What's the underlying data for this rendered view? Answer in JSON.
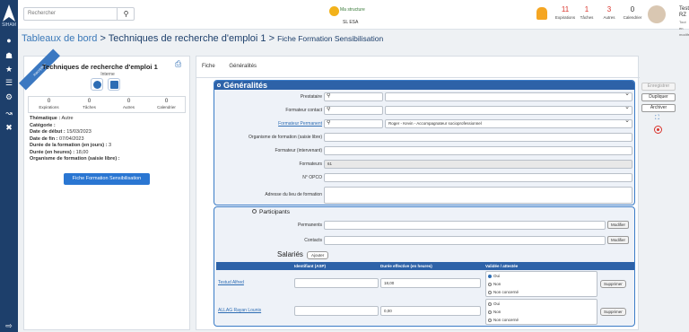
{
  "sidebar": {
    "logo_text": "SIHAM",
    "icons": [
      "home-icon",
      "dashboard-icon",
      "star-icon",
      "sliders-icon",
      "settings-icon",
      "coins-icon",
      "chart-icon",
      "tools-icon",
      "logout-icon"
    ]
  },
  "topbar": {
    "search_placeholder": "Rechercher",
    "structure_name": "Ma structure",
    "structure_sub": "SL ESA",
    "counters": [
      {
        "value": "11",
        "label": "Expirations",
        "red": true
      },
      {
        "value": "1",
        "label": "Tâches",
        "red": true
      },
      {
        "value": "3",
        "label": "Autres",
        "red": true
      },
      {
        "value": "0",
        "label": "Calendrier",
        "red": false
      }
    ],
    "user_name": "Test RZ",
    "user_sub": "Tout en modifs"
  },
  "breadcrumb": {
    "root": "Tableaux de bord",
    "sep": ">",
    "level2": "Techniques de recherche d'emploi 1",
    "level3": "Fiche Formation Sensibilisation"
  },
  "left_panel": {
    "ribbon": "Inscription",
    "title": "Techniques de recherche d'emploi 1",
    "type": "Interne",
    "stats": [
      {
        "value": "0",
        "label": "Expirations"
      },
      {
        "value": "0",
        "label": "Tâches"
      },
      {
        "value": "0",
        "label": "Autres"
      },
      {
        "value": "0",
        "label": "Calendrier"
      }
    ],
    "info": [
      {
        "label": "Thématique :",
        "value": "Autre"
      },
      {
        "label": "Catégorie :",
        "value": ""
      },
      {
        "label": "Date de début :",
        "value": "15/03/2023"
      },
      {
        "label": "Date de fin :",
        "value": "07/04/2023"
      },
      {
        "label": "Durée de la formation (en jours) :",
        "value": "3"
      },
      {
        "label": "Durée (en heures) :",
        "value": "18,00"
      },
      {
        "label": "Organisme de formation (saisie libre) :",
        "value": ""
      }
    ],
    "button": "Fiche Formation Sensibilisation"
  },
  "tabs": [
    "Fiche",
    "Généralités"
  ],
  "generalites": {
    "title": "Généralités",
    "fields": [
      {
        "label": "Prestataire",
        "value": "",
        "link": false
      },
      {
        "label": "Formateur contact",
        "value": "",
        "link": false
      },
      {
        "label": "Formateur Permanent",
        "value": "Roger - Kevin - Accompagnateur socioprofessionnel",
        "link": true
      },
      {
        "label": "Organisme de formation (saisie libre)",
        "value": "",
        "link": false
      },
      {
        "label": "Formateur (intervenant)",
        "value": "",
        "link": false
      },
      {
        "label": "Formateurs",
        "value": "61",
        "link": false
      },
      {
        "label": "N° OPCO",
        "value": "",
        "link": false
      },
      {
        "label": "Adresse du lieu de formation",
        "value": "",
        "link": false
      }
    ]
  },
  "participants": {
    "title": "Participants",
    "permanents_label": "Permanents",
    "contacts_label": "Contacts",
    "modifier": "Modifier",
    "salaries_title": "Salariés",
    "ajouter": "Ajouter",
    "columns": [
      "Identifiant (ASP)",
      "Durée effective (en heures)",
      "Validée / attestée"
    ],
    "rows": [
      {
        "name": "Testud Alfred",
        "id": "",
        "duration": "18,00",
        "options": [
          "Oui",
          "Non",
          "Non concerné"
        ],
        "selected": 0
      },
      {
        "name": "ALLAG Rayan Lounis",
        "id": "",
        "duration": "0,00",
        "options": [
          "Oui",
          "Non",
          "Non concerné"
        ],
        "selected": -1
      }
    ],
    "supprimer": "Supprimer"
  },
  "actions": {
    "save": "Enregistrer",
    "duplicate": "Dupliquer",
    "archive": "Archiver"
  }
}
